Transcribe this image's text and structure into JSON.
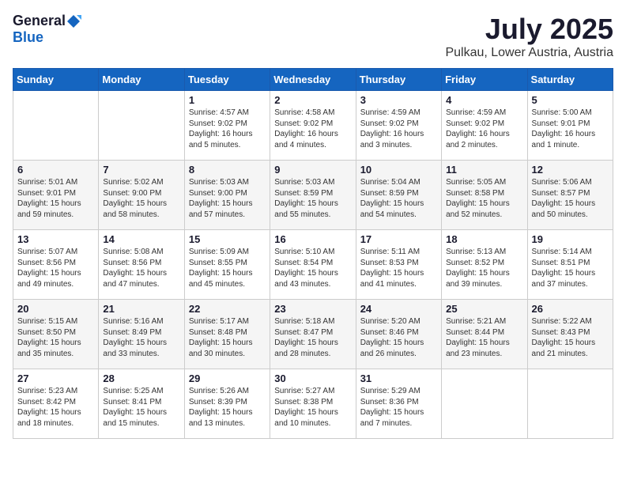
{
  "logo": {
    "general": "General",
    "blue": "Blue"
  },
  "title": "July 2025",
  "location": "Pulkau, Lower Austria, Austria",
  "days_of_week": [
    "Sunday",
    "Monday",
    "Tuesday",
    "Wednesday",
    "Thursday",
    "Friday",
    "Saturday"
  ],
  "weeks": [
    [
      {
        "day": "",
        "info": ""
      },
      {
        "day": "",
        "info": ""
      },
      {
        "day": "1",
        "info": "Sunrise: 4:57 AM\nSunset: 9:02 PM\nDaylight: 16 hours\nand 5 minutes."
      },
      {
        "day": "2",
        "info": "Sunrise: 4:58 AM\nSunset: 9:02 PM\nDaylight: 16 hours\nand 4 minutes."
      },
      {
        "day": "3",
        "info": "Sunrise: 4:59 AM\nSunset: 9:02 PM\nDaylight: 16 hours\nand 3 minutes."
      },
      {
        "day": "4",
        "info": "Sunrise: 4:59 AM\nSunset: 9:02 PM\nDaylight: 16 hours\nand 2 minutes."
      },
      {
        "day": "5",
        "info": "Sunrise: 5:00 AM\nSunset: 9:01 PM\nDaylight: 16 hours\nand 1 minute."
      }
    ],
    [
      {
        "day": "6",
        "info": "Sunrise: 5:01 AM\nSunset: 9:01 PM\nDaylight: 15 hours\nand 59 minutes."
      },
      {
        "day": "7",
        "info": "Sunrise: 5:02 AM\nSunset: 9:00 PM\nDaylight: 15 hours\nand 58 minutes."
      },
      {
        "day": "8",
        "info": "Sunrise: 5:03 AM\nSunset: 9:00 PM\nDaylight: 15 hours\nand 57 minutes."
      },
      {
        "day": "9",
        "info": "Sunrise: 5:03 AM\nSunset: 8:59 PM\nDaylight: 15 hours\nand 55 minutes."
      },
      {
        "day": "10",
        "info": "Sunrise: 5:04 AM\nSunset: 8:59 PM\nDaylight: 15 hours\nand 54 minutes."
      },
      {
        "day": "11",
        "info": "Sunrise: 5:05 AM\nSunset: 8:58 PM\nDaylight: 15 hours\nand 52 minutes."
      },
      {
        "day": "12",
        "info": "Sunrise: 5:06 AM\nSunset: 8:57 PM\nDaylight: 15 hours\nand 50 minutes."
      }
    ],
    [
      {
        "day": "13",
        "info": "Sunrise: 5:07 AM\nSunset: 8:56 PM\nDaylight: 15 hours\nand 49 minutes."
      },
      {
        "day": "14",
        "info": "Sunrise: 5:08 AM\nSunset: 8:56 PM\nDaylight: 15 hours\nand 47 minutes."
      },
      {
        "day": "15",
        "info": "Sunrise: 5:09 AM\nSunset: 8:55 PM\nDaylight: 15 hours\nand 45 minutes."
      },
      {
        "day": "16",
        "info": "Sunrise: 5:10 AM\nSunset: 8:54 PM\nDaylight: 15 hours\nand 43 minutes."
      },
      {
        "day": "17",
        "info": "Sunrise: 5:11 AM\nSunset: 8:53 PM\nDaylight: 15 hours\nand 41 minutes."
      },
      {
        "day": "18",
        "info": "Sunrise: 5:13 AM\nSunset: 8:52 PM\nDaylight: 15 hours\nand 39 minutes."
      },
      {
        "day": "19",
        "info": "Sunrise: 5:14 AM\nSunset: 8:51 PM\nDaylight: 15 hours\nand 37 minutes."
      }
    ],
    [
      {
        "day": "20",
        "info": "Sunrise: 5:15 AM\nSunset: 8:50 PM\nDaylight: 15 hours\nand 35 minutes."
      },
      {
        "day": "21",
        "info": "Sunrise: 5:16 AM\nSunset: 8:49 PM\nDaylight: 15 hours\nand 33 minutes."
      },
      {
        "day": "22",
        "info": "Sunrise: 5:17 AM\nSunset: 8:48 PM\nDaylight: 15 hours\nand 30 minutes."
      },
      {
        "day": "23",
        "info": "Sunrise: 5:18 AM\nSunset: 8:47 PM\nDaylight: 15 hours\nand 28 minutes."
      },
      {
        "day": "24",
        "info": "Sunrise: 5:20 AM\nSunset: 8:46 PM\nDaylight: 15 hours\nand 26 minutes."
      },
      {
        "day": "25",
        "info": "Sunrise: 5:21 AM\nSunset: 8:44 PM\nDaylight: 15 hours\nand 23 minutes."
      },
      {
        "day": "26",
        "info": "Sunrise: 5:22 AM\nSunset: 8:43 PM\nDaylight: 15 hours\nand 21 minutes."
      }
    ],
    [
      {
        "day": "27",
        "info": "Sunrise: 5:23 AM\nSunset: 8:42 PM\nDaylight: 15 hours\nand 18 minutes."
      },
      {
        "day": "28",
        "info": "Sunrise: 5:25 AM\nSunset: 8:41 PM\nDaylight: 15 hours\nand 15 minutes."
      },
      {
        "day": "29",
        "info": "Sunrise: 5:26 AM\nSunset: 8:39 PM\nDaylight: 15 hours\nand 13 minutes."
      },
      {
        "day": "30",
        "info": "Sunrise: 5:27 AM\nSunset: 8:38 PM\nDaylight: 15 hours\nand 10 minutes."
      },
      {
        "day": "31",
        "info": "Sunrise: 5:29 AM\nSunset: 8:36 PM\nDaylight: 15 hours\nand 7 minutes."
      },
      {
        "day": "",
        "info": ""
      },
      {
        "day": "",
        "info": ""
      }
    ]
  ]
}
